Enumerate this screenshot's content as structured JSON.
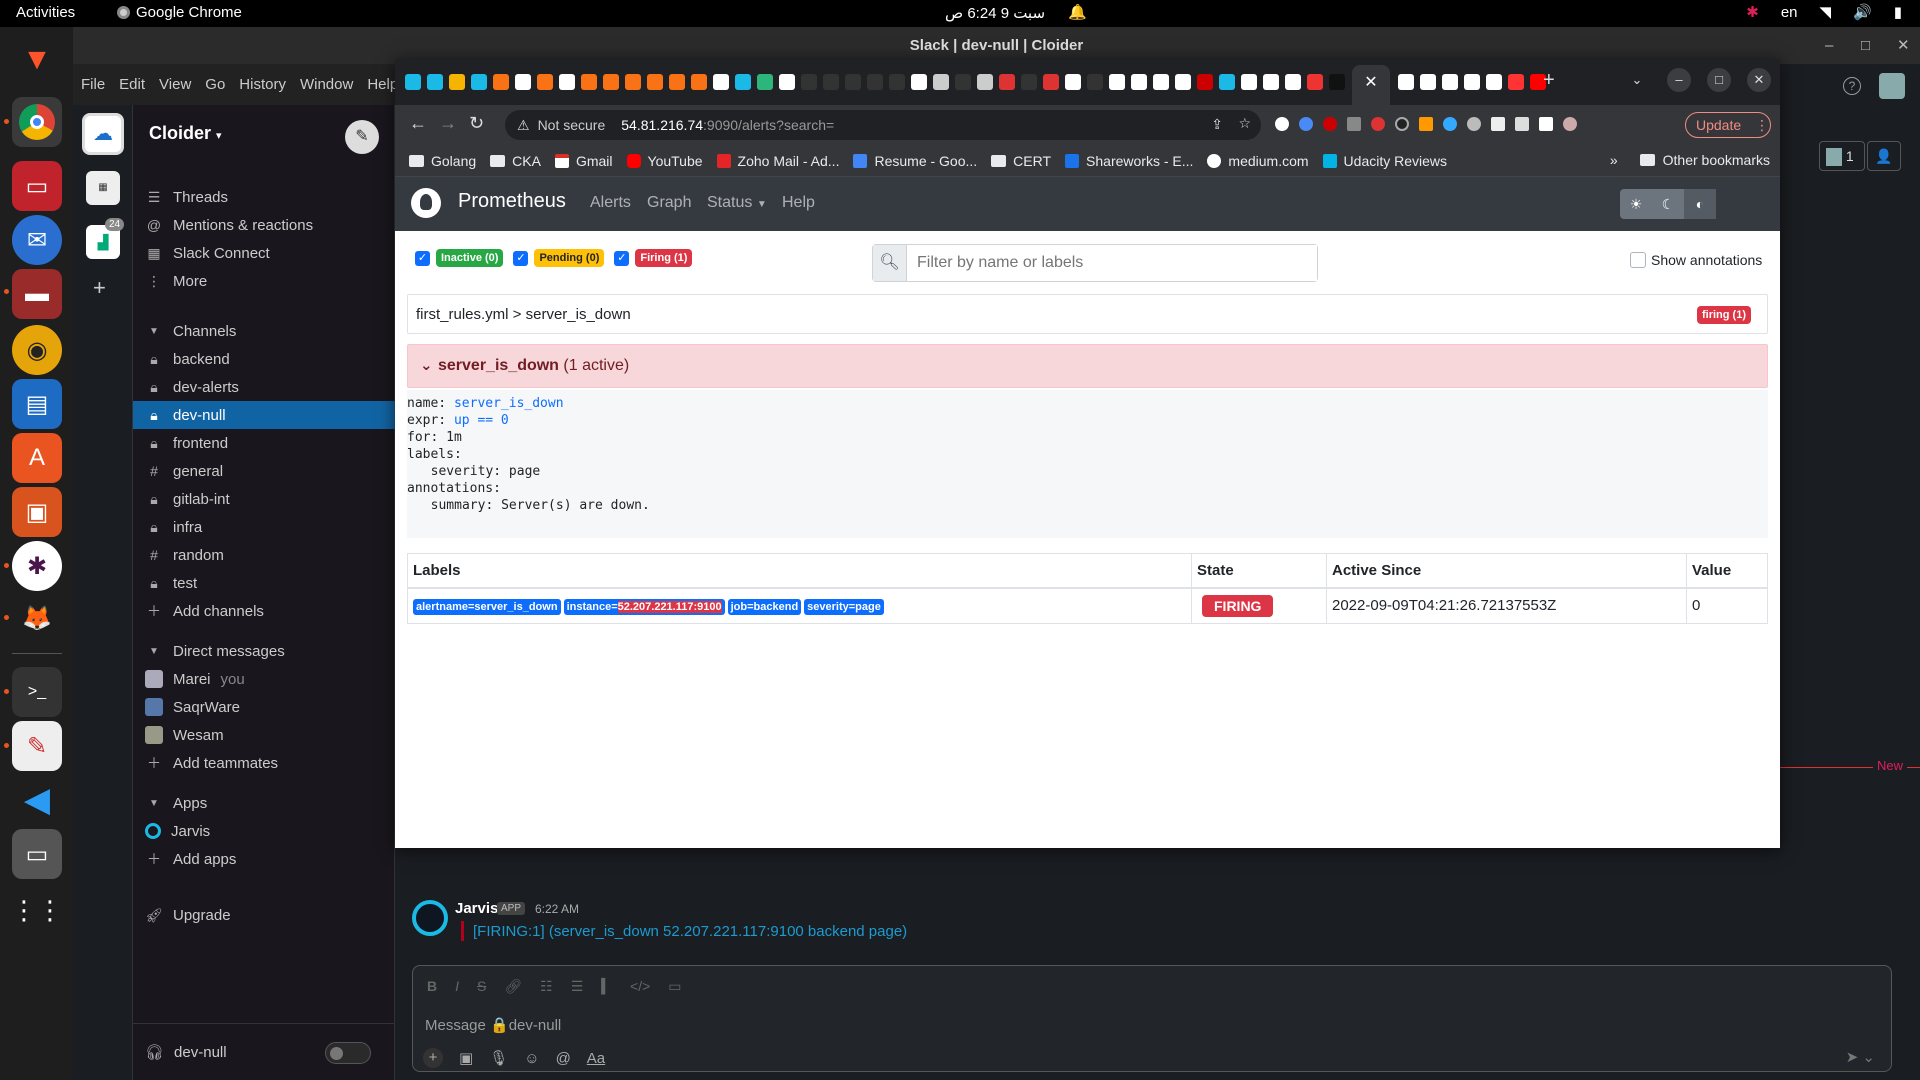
{
  "topbar": {
    "activities": "Activities",
    "app_name": "Google Chrome",
    "clock": "سبت 9  6:24 ص",
    "keyboard": "en"
  },
  "slack": {
    "window_title": "Slack | dev-null | Cloider",
    "menu": [
      "File",
      "Edit",
      "View",
      "Go",
      "History",
      "Window",
      "Help"
    ],
    "workspace": "Cloider",
    "workspace_badge": "24",
    "nav": [
      {
        "icon": "threads-icon",
        "label": "Threads"
      },
      {
        "icon": "at-icon",
        "label": "Mentions & reactions"
      },
      {
        "icon": "building-icon",
        "label": "Slack Connect"
      },
      {
        "icon": "more-icon",
        "label": "More"
      }
    ],
    "channels_header": "Channels",
    "channels": [
      {
        "label": "backend",
        "icon": "lock"
      },
      {
        "label": "dev-alerts",
        "icon": "lock"
      },
      {
        "label": "dev-null",
        "icon": "lock",
        "active": true
      },
      {
        "label": "frontend",
        "icon": "lock"
      },
      {
        "label": "general",
        "icon": "hash"
      },
      {
        "label": "gitlab-int",
        "icon": "lock"
      },
      {
        "label": "infra",
        "icon": "lock"
      },
      {
        "label": "random",
        "icon": "hash"
      },
      {
        "label": "test",
        "icon": "lock"
      }
    ],
    "add_channels": "Add channels",
    "dm_header": "Direct messages",
    "dms": [
      {
        "label": "Marei",
        "sub": "you"
      },
      {
        "label": "SaqrWare",
        "sub": ""
      },
      {
        "label": "Wesam",
        "sub": ""
      }
    ],
    "add_teammates": "Add teammates",
    "apps_header": "Apps",
    "apps": [
      {
        "label": "Jarvis"
      }
    ],
    "add_apps": "Add apps",
    "upgrade": "Upgrade",
    "bottom_channel": "dev-null",
    "member_count": "1",
    "new_label": "New",
    "message": {
      "author": "Jarvis",
      "app_tag": "APP",
      "time": "6:22 AM",
      "text": "[FIRING:1]  (server_is_down 52.207.221.117:9100 backend page)"
    },
    "composer_placeholder": "Message 🔒dev-null"
  },
  "chrome": {
    "url_warning": "Not secure",
    "url_host": "54.81.216.74",
    "url_path": ":9090/alerts?search=",
    "update_label": "Update",
    "bookmarks": [
      {
        "label": "Golang",
        "type": "folder"
      },
      {
        "label": "CKA",
        "type": "folder"
      },
      {
        "label": "Gmail",
        "type": "gmail"
      },
      {
        "label": "YouTube",
        "type": "youtube"
      },
      {
        "label": "Zoho Mail - Ad...",
        "type": "zoho"
      },
      {
        "label": "Resume - Goo...",
        "type": "docs"
      },
      {
        "label": "CERT",
        "type": "folder"
      },
      {
        "label": "Shareworks - E...",
        "type": "shareworks"
      },
      {
        "label": "medium.com",
        "type": "medium"
      },
      {
        "label": "Udacity Reviews",
        "type": "udacity"
      }
    ],
    "other_bookmarks": "Other bookmarks",
    "overflow": "»"
  },
  "prometheus": {
    "brand": "Prometheus",
    "nav": [
      "Alerts",
      "Graph",
      "Status",
      "Help"
    ],
    "filters": [
      {
        "label": "Inactive (0)",
        "kind": "inactive"
      },
      {
        "label": "Pending (0)",
        "kind": "pending"
      },
      {
        "label": "Firing (1)",
        "kind": "firing"
      }
    ],
    "search_placeholder": "Filter by name or labels",
    "show_annotations": "Show annotations",
    "rule_path": "first_rules.yml > server_is_down",
    "rule_badge": "firing (1)",
    "alert_name": "server_is_down",
    "alert_count": "(1 active)",
    "rule": {
      "name_key": "name: ",
      "name_val": "server_is_down",
      "expr_key": "expr: ",
      "expr_val": "up == 0",
      "for_line": "for: 1m",
      "labels_line": "labels:",
      "severity_line": "  severity: page",
      "annotations_line": "annotations:",
      "summary_line": "  summary: Server(s) are down."
    },
    "table": {
      "headers": [
        "Labels",
        "State",
        "Active Since",
        "Value"
      ],
      "labels": [
        "alertname=server_is_down",
        "instance=",
        "52.207.221.117:9100",
        "job=backend",
        "severity=page"
      ],
      "state": "FIRING",
      "active_since": "2022-09-09T04:21:26.72137553Z",
      "value": "0"
    }
  }
}
